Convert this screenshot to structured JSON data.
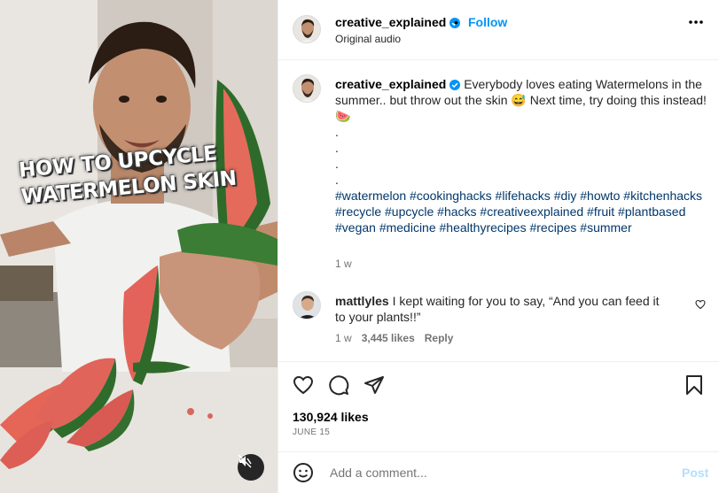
{
  "media": {
    "overlay_line1": "HOW TO UPCYCLE",
    "overlay_line2": "WATERMELON SKIN",
    "mute_icon": "speaker-muted-icon"
  },
  "header": {
    "username": "creative_explained",
    "separator": "•",
    "follow_label": "Follow",
    "audio_label": "Original audio",
    "more_icon": "more-options-icon"
  },
  "caption": {
    "username": "creative_explained",
    "text": "Everybody loves eating Watermelons in the summer.. but throw out the skin 😅 Next time, try doing this instead! 🍉",
    "dots": [
      ".",
      ".",
      ".",
      "."
    ],
    "hashtags": "#watermelon #cookinghacks #lifehacks #diy #howto #kitchenhacks #recycle #upcycle #hacks #creativeexplained #fruit #plantbased #vegan #medicine #healthyrecipes #recipes #summer",
    "time": "1 w"
  },
  "comment": {
    "username": "mattlyles",
    "text": "I kept waiting for you to say, “And you can feed it to your plants!!”",
    "time": "1 w",
    "likes": "3,445 likes",
    "reply_label": "Reply"
  },
  "post_stats": {
    "likes": "130,924 likes",
    "date": "JUNE 15"
  },
  "add_comment": {
    "placeholder": "Add a comment...",
    "post_label": "Post"
  },
  "colors": {
    "accent": "#0095f6",
    "link": "#00376b",
    "muted": "#737373"
  }
}
